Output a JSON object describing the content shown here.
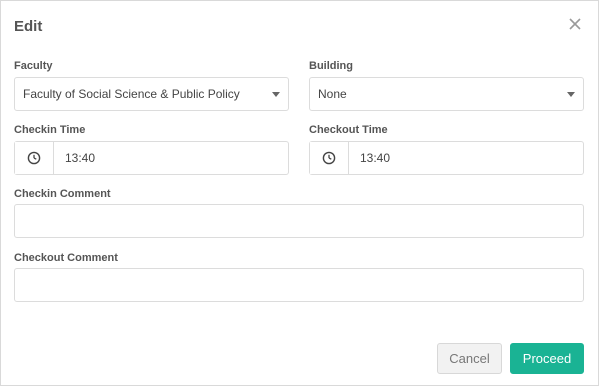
{
  "dialog": {
    "title": "Edit"
  },
  "fields": {
    "faculty": {
      "label": "Faculty",
      "value": "Faculty of Social Science & Public Policy"
    },
    "building": {
      "label": "Building",
      "value": "None"
    },
    "checkin_time": {
      "label": "Checkin Time",
      "value": "13:40"
    },
    "checkout_time": {
      "label": "Checkout Time",
      "value": "13:40"
    },
    "checkin_comment": {
      "label": "Checkin Comment",
      "value": ""
    },
    "checkout_comment": {
      "label": "Checkout Comment",
      "value": ""
    }
  },
  "buttons": {
    "cancel": "Cancel",
    "proceed": "Proceed"
  },
  "colors": {
    "primary": "#1ab394",
    "border": "#dcdcdc"
  },
  "icons": {
    "close": "close-icon",
    "clock": "clock-icon",
    "dropdown": "caret-down-icon"
  }
}
